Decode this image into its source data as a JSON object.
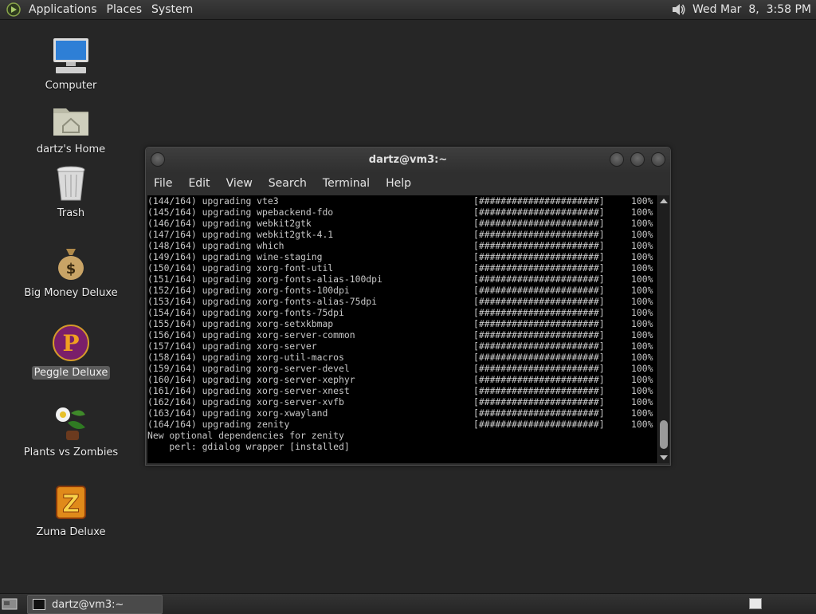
{
  "top_panel": {
    "menus": [
      "Applications",
      "Places",
      "System"
    ],
    "clock": "Wed Mar  8,  3:58 PM"
  },
  "desktop": {
    "icons": [
      {
        "label": "Computer",
        "icon": "computer-icon"
      },
      {
        "label": "dartz's Home",
        "icon": "home-folder-icon"
      },
      {
        "label": "Trash",
        "icon": "trash-icon"
      },
      {
        "label": "Big Money Deluxe",
        "icon": "money-bag-icon"
      },
      {
        "label": "Peggle Deluxe",
        "icon": "peggle-icon",
        "selected": true
      },
      {
        "label": "Plants vs Zombies",
        "icon": "plants-icon"
      },
      {
        "label": "Zuma Deluxe",
        "icon": "zuma-icon"
      }
    ]
  },
  "terminal": {
    "title": "dartz@vm3:~",
    "menu": [
      "File",
      "Edit",
      "View",
      "Search",
      "Terminal",
      "Help"
    ],
    "progress": "[######################]",
    "lines": [
      {
        "text": "(144/164) upgrading vte3",
        "pct": "100%"
      },
      {
        "text": "(145/164) upgrading wpebackend-fdo",
        "pct": "100%"
      },
      {
        "text": "(146/164) upgrading webkit2gtk",
        "pct": "100%"
      },
      {
        "text": "(147/164) upgrading webkit2gtk-4.1",
        "pct": "100%"
      },
      {
        "text": "(148/164) upgrading which",
        "pct": "100%"
      },
      {
        "text": "(149/164) upgrading wine-staging",
        "pct": "100%"
      },
      {
        "text": "(150/164) upgrading xorg-font-util",
        "pct": "100%"
      },
      {
        "text": "(151/164) upgrading xorg-fonts-alias-100dpi",
        "pct": "100%"
      },
      {
        "text": "(152/164) upgrading xorg-fonts-100dpi",
        "pct": "100%"
      },
      {
        "text": "(153/164) upgrading xorg-fonts-alias-75dpi",
        "pct": "100%"
      },
      {
        "text": "(154/164) upgrading xorg-fonts-75dpi",
        "pct": "100%"
      },
      {
        "text": "(155/164) upgrading xorg-setxkbmap",
        "pct": "100%"
      },
      {
        "text": "(156/164) upgrading xorg-server-common",
        "pct": "100%"
      },
      {
        "text": "(157/164) upgrading xorg-server",
        "pct": "100%"
      },
      {
        "text": "(158/164) upgrading xorg-util-macros",
        "pct": "100%"
      },
      {
        "text": "(159/164) upgrading xorg-server-devel",
        "pct": "100%"
      },
      {
        "text": "(160/164) upgrading xorg-server-xephyr",
        "pct": "100%"
      },
      {
        "text": "(161/164) upgrading xorg-server-xnest",
        "pct": "100%"
      },
      {
        "text": "(162/164) upgrading xorg-server-xvfb",
        "pct": "100%"
      },
      {
        "text": "(163/164) upgrading xorg-xwayland",
        "pct": "100%"
      },
      {
        "text": "(164/164) upgrading zenity",
        "pct": "100%"
      }
    ],
    "footer": [
      "New optional dependencies for zenity",
      "    perl: gdialog wrapper [installed]"
    ]
  },
  "taskbar": {
    "task_label": "dartz@vm3:~"
  },
  "colors": {
    "desktop_bg": "#262626",
    "terminal_bg": "#000000",
    "terminal_fg": "#c8c8c8",
    "selected_label_bg": "#5c5c5c"
  }
}
